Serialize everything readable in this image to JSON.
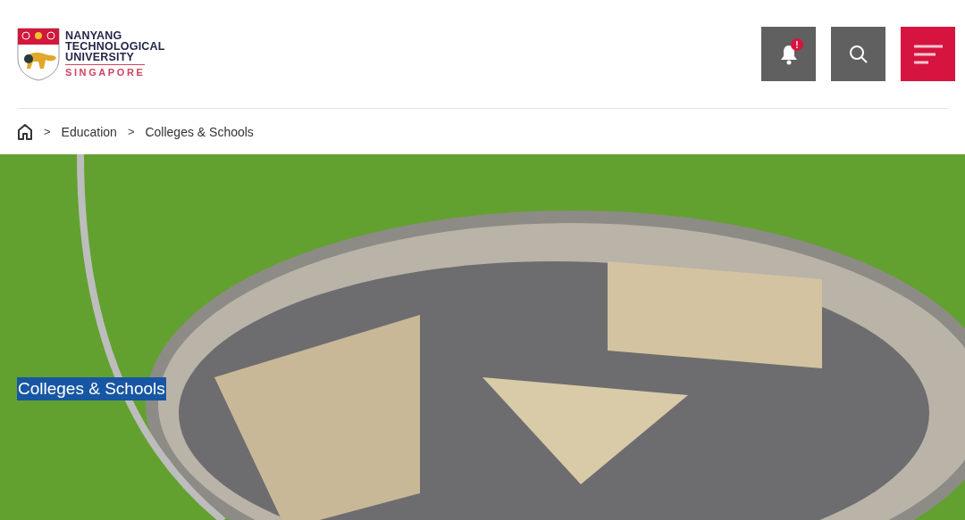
{
  "logo": {
    "lines": [
      "NANYANG",
      "TECHNOLOGICAL",
      "UNIVERSITY"
    ],
    "tagline": "SINGAPORE"
  },
  "header_actions": {
    "notification_badge": "!"
  },
  "breadcrumb": [
    "Education",
    "Colleges & Schools"
  ],
  "breadcrumb_separators": [
    ">",
    ">"
  ],
  "hero": {
    "title": "Colleges & Schools"
  }
}
